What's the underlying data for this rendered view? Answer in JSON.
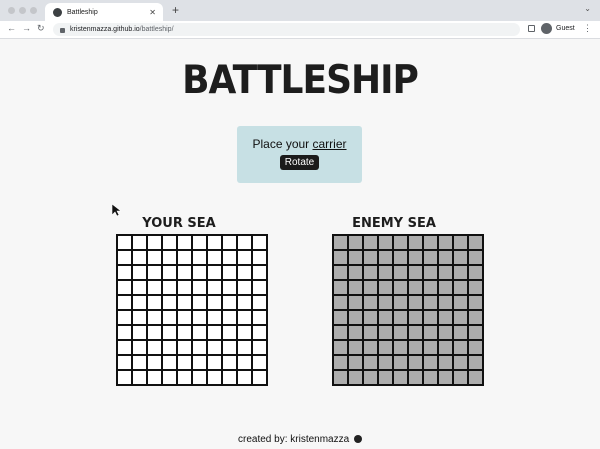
{
  "browser": {
    "tab_title": "Battleship",
    "tab_icon": "globe-icon",
    "new_tab_label": "+",
    "url_host": "kristenmazza.github.io",
    "url_path": "/battleship/",
    "profile_label": "Guest"
  },
  "page": {
    "title": "BATTLESHIP",
    "status_prefix": "Place your ",
    "status_ship": "carrier",
    "rotate_label": "Rotate",
    "your_sea_label": "YOUR SEA",
    "enemy_sea_label": "ENEMY SEA",
    "footer_text": "created by: kristenmazza",
    "footer_icon": "github-icon"
  },
  "board": {
    "rows": 10,
    "cols": 10
  },
  "colors": {
    "status_box": "#c7e0e4",
    "enemy_cell": "#adadad",
    "your_cell": "#ffffff",
    "rotate_button": "#1b1b1b"
  }
}
